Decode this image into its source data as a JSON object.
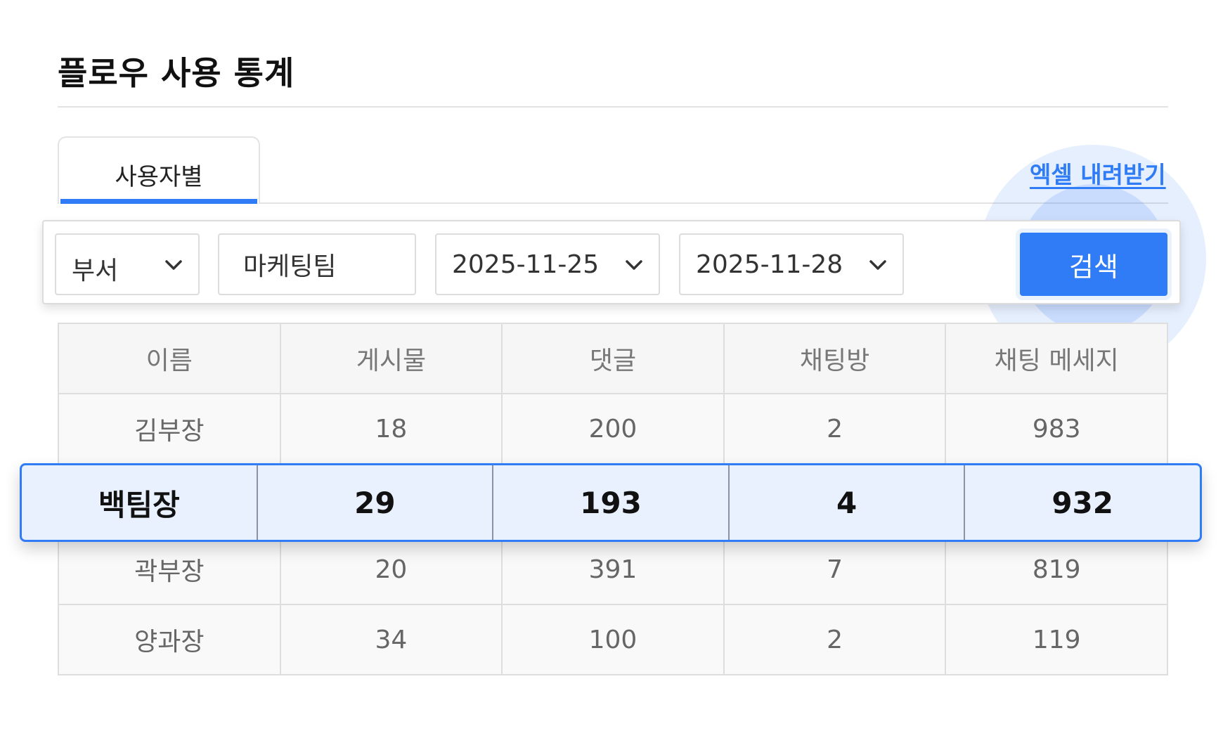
{
  "page": {
    "title": "플로우 사용 통계"
  },
  "tabs": [
    {
      "label": "사용자별",
      "active": true
    }
  ],
  "actions": {
    "excel_download_label": "엑셀 내려받기"
  },
  "filters": {
    "category_select": {
      "value": "부서"
    },
    "keyword_input": {
      "value": "마케팅팀"
    },
    "start_date_select": {
      "value": "2025-11-25"
    },
    "end_date_select": {
      "value": "2025-11-28"
    },
    "search_button_label": "검색"
  },
  "colors": {
    "accent": "#2f7cf6",
    "highlight_bg": "#eaf1fe"
  },
  "table": {
    "columns": [
      "이름",
      "게시물",
      "댓글",
      "채팅방",
      "채팅 메세지"
    ],
    "rows": [
      {
        "cells": [
          "김부장",
          "18",
          "200",
          "2",
          "983"
        ]
      },
      {
        "cells": [
          "백팀장",
          "29",
          "193",
          "4",
          "932"
        ],
        "highlighted": true
      },
      {
        "cells": [
          "곽부장",
          "20",
          "391",
          "7",
          "819"
        ]
      },
      {
        "cells": [
          "양과장",
          "34",
          "100",
          "2",
          "119"
        ]
      }
    ]
  },
  "icons": {
    "dropdown": "chevron-down-icon"
  }
}
